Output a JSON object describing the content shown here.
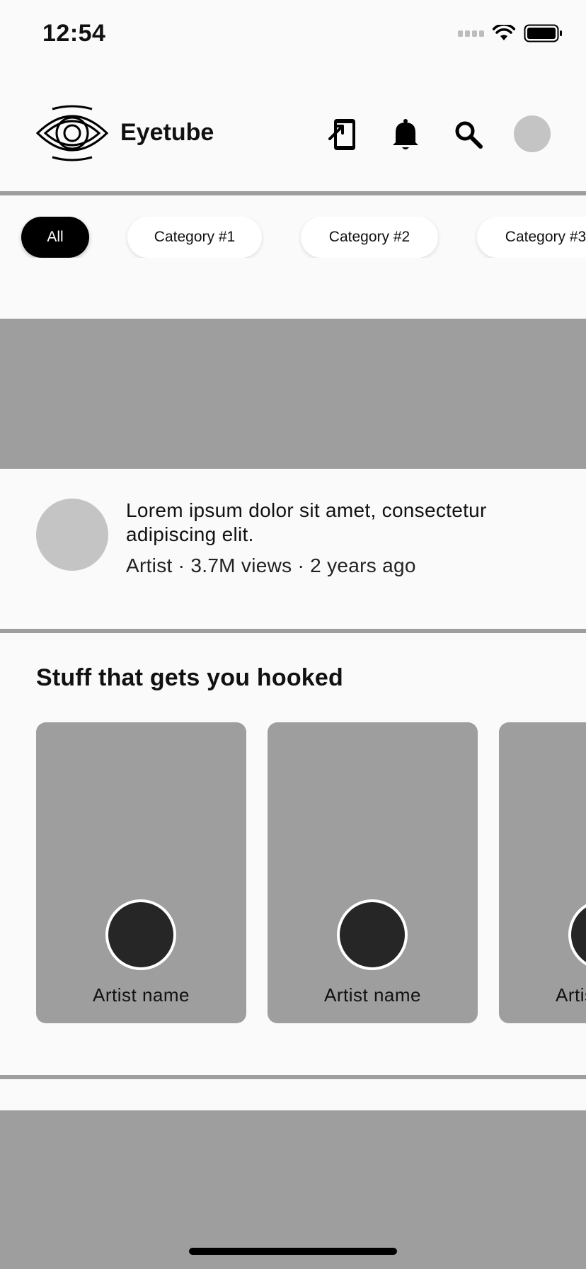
{
  "status_bar": {
    "time": "12:54"
  },
  "header": {
    "app_name": "Eyetube",
    "icons": [
      "eye-logo-icon",
      "cast-device-icon",
      "bell-icon",
      "search-icon",
      "avatar"
    ]
  },
  "chips": [
    {
      "label": "All",
      "selected": true
    },
    {
      "label": "Category #1",
      "selected": false
    },
    {
      "label": "Category #2",
      "selected": false
    },
    {
      "label": "Category #3",
      "selected": false
    }
  ],
  "featured_video": {
    "title": "Lorem ipsum dolor sit amet, consectetur adipiscing elit.",
    "meta": "Artist · 3.7M views · 2 years ago"
  },
  "section": {
    "title": "Stuff that gets you hooked",
    "artists": [
      {
        "name": "Artist name"
      },
      {
        "name": "Artist name"
      },
      {
        "name": "Artist name"
      }
    ]
  },
  "colors": {
    "background": "#fafafa",
    "placeholder_gray": "#9e9e9e",
    "avatar_gray": "#c4c4c4",
    "chip_active": "#000000",
    "artist_avatar": "#262626"
  }
}
